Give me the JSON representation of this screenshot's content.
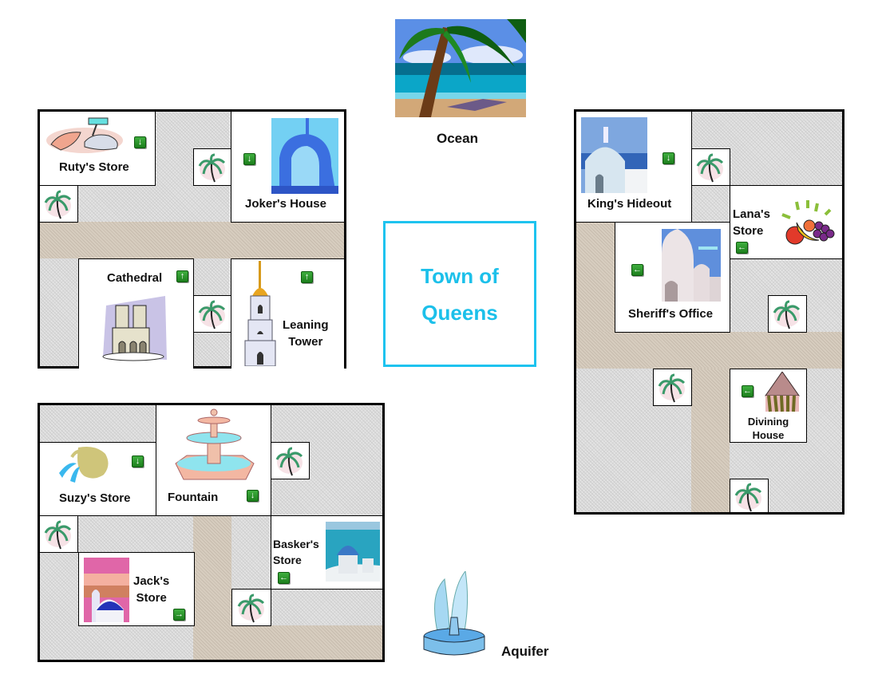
{
  "map": {
    "title": "Town of\nQueens",
    "colors": {
      "title": "#1cc0ea",
      "road": "#d7cdbf",
      "door_arrow": "#2f9a2f",
      "block_border": "#000000"
    },
    "landmarks": {
      "ocean": "Ocean",
      "aquifer": "Aquifer"
    },
    "buildings": {
      "ruty": {
        "label": "Ruty's Store",
        "door": "down",
        "door_glyph": "↓"
      },
      "joker": {
        "label": "Joker's House",
        "door": "down",
        "door_glyph": "↓"
      },
      "cathedral": {
        "label": "Cathedral",
        "door": "up",
        "door_glyph": "↑"
      },
      "leaning": {
        "label": "Leaning\nTower",
        "door": "up",
        "door_glyph": "↑"
      },
      "king": {
        "label": "King's Hideout",
        "door": "down",
        "door_glyph": "↓"
      },
      "lana": {
        "label": "Lana's\nStore",
        "door": "left",
        "door_glyph": "←"
      },
      "sheriff": {
        "label": "Sheriff's Office",
        "door": "left",
        "door_glyph": "←"
      },
      "divining": {
        "label": "Divining\nHouse",
        "door": "left",
        "door_glyph": "←"
      },
      "suzy": {
        "label": "Suzy's Store",
        "door": "down",
        "door_glyph": "↓"
      },
      "fountain": {
        "label": "Fountain",
        "door": "down",
        "door_glyph": "↓"
      },
      "jack": {
        "label": "Jack's\nStore",
        "door": "right",
        "door_glyph": "→"
      },
      "basker": {
        "label": "Basker's\nStore",
        "door": "left",
        "door_glyph": "←"
      }
    },
    "icons": {
      "palm": "palm-tree-icon",
      "door": "door-arrow-icon"
    }
  }
}
